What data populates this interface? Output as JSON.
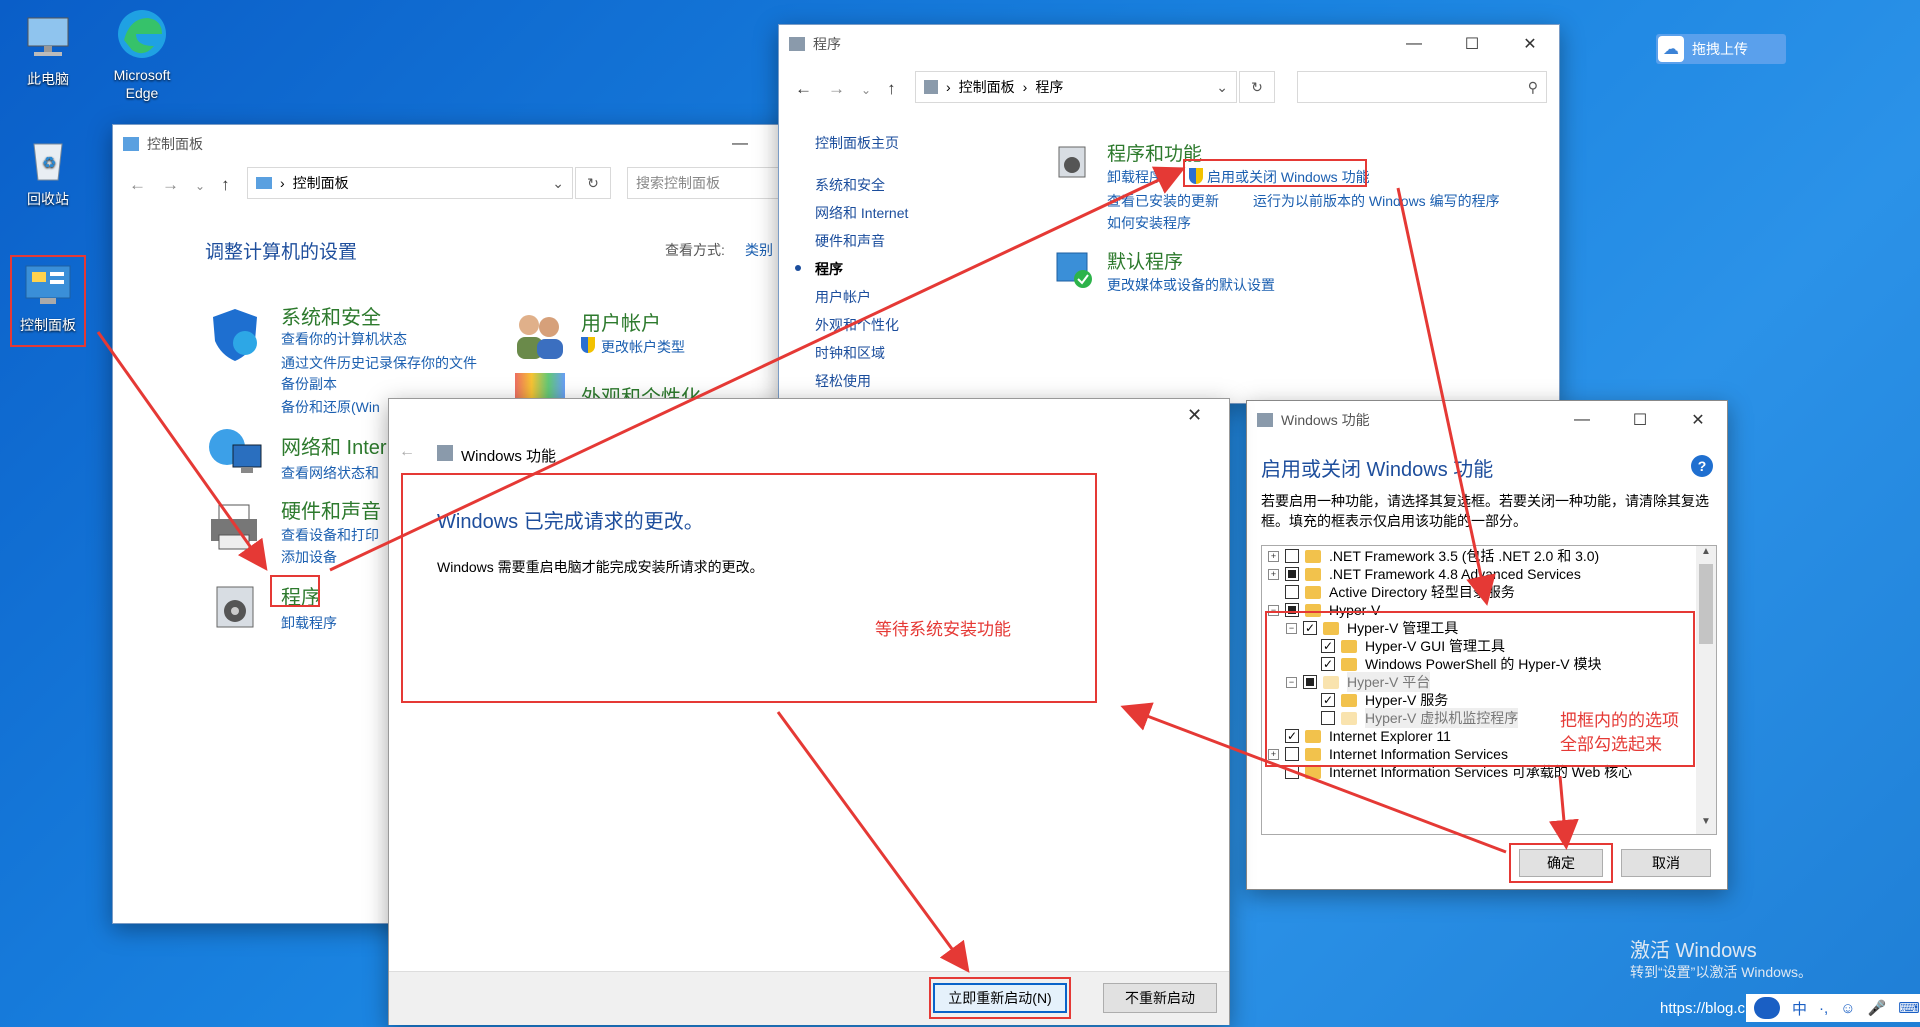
{
  "desktop": {
    "icons": [
      {
        "label": "此电脑",
        "icon": "computer-icon"
      },
      {
        "label": "Microsoft Edge",
        "icon": "edge-icon"
      },
      {
        "label": "回收站",
        "icon": "recycle-bin-icon"
      },
      {
        "label": "控制面板",
        "icon": "control-panel-icon"
      }
    ],
    "upload_button": "拖拽上传",
    "activate_title": "激活 Windows",
    "activate_sub": "转到“设置”以激活 Windows。",
    "url_watermark": "https://blog.c",
    "tray": [
      "中",
      "·,"
    ]
  },
  "cp_window": {
    "title": "控制面板",
    "address": "控制面板",
    "search_placeholder": "搜索控制面板",
    "heading": "调整计算机的设置",
    "view_label": "查看方式:",
    "view_value": "类别",
    "categories": {
      "system": {
        "title": "系统和安全",
        "links": [
          "查看你的计算机状态",
          "通过文件历史记录保存你的文件",
          "备份副本",
          "备份和还原(Win"
        ]
      },
      "user": {
        "title": "用户帐户",
        "links": [
          "更改帐户类型"
        ]
      },
      "appearance": {
        "title": "外观和个性化"
      },
      "network": {
        "title": "网络和 Inter",
        "links": [
          "查看网络状态和"
        ]
      },
      "hardware": {
        "title": "硬件和声音",
        "links": [
          "查看设备和打印",
          "添加设备"
        ]
      },
      "programs": {
        "title": "程序",
        "links": [
          "卸载程序"
        ]
      }
    }
  },
  "prog_window": {
    "title": "程序",
    "breadcrumb": [
      "控制面板",
      "程序"
    ],
    "sidebar": [
      "控制面板主页",
      "系统和安全",
      "网络和 Internet",
      "硬件和声音",
      "程序",
      "用户帐户",
      "外观和个性化",
      "时钟和区域",
      "轻松使用"
    ],
    "section1_title": "程序和功能",
    "section1_links": [
      "卸载程序",
      "启用或关闭 Windows 功能",
      "查看已安装的更新",
      "运行为以前版本的 Windows 编写的程序",
      "如何安装程序"
    ],
    "section2_title": "默认程序",
    "section2_links": [
      "更改媒体或设备的默认设置"
    ]
  },
  "features_window": {
    "title": "Windows 功能",
    "heading": "启用或关闭 Windows 功能",
    "help": "?",
    "description": "若要启用一种功能，请选择其复选框。若要关闭一种功能，请清除其复选框。填充的框表示仅启用该功能的一部分。",
    "items": [
      {
        "label": ".NET Framework 3.5 (包括 .NET 2.0 和 3.0)",
        "state": "unchecked",
        "expand": "+",
        "level": 0
      },
      {
        "label": ".NET Framework 4.8 Advanced Services",
        "state": "partial",
        "expand": "+",
        "level": 0
      },
      {
        "label": "Active Directory 轻型目录服务",
        "state": "unchecked",
        "expand": "",
        "level": 0
      },
      {
        "label": "Hyper-V",
        "state": "partial",
        "expand": "−",
        "level": 0
      },
      {
        "label": "Hyper-V 管理工具",
        "state": "checked",
        "expand": "−",
        "level": 1
      },
      {
        "label": "Hyper-V GUI 管理工具",
        "state": "checked",
        "expand": "",
        "level": 2
      },
      {
        "label": "Windows PowerShell 的 Hyper-V 模块",
        "state": "checked",
        "expand": "",
        "level": 2
      },
      {
        "label": "Hyper-V 平台",
        "state": "partial",
        "expand": "−",
        "level": 1,
        "grey": true
      },
      {
        "label": "Hyper-V 服务",
        "state": "checked",
        "expand": "",
        "level": 2
      },
      {
        "label": "Hyper-V 虚拟机监控程序",
        "state": "unchecked",
        "expand": "",
        "level": 2,
        "grey": true
      },
      {
        "label": "Internet Explorer 11",
        "state": "checked",
        "expand": "",
        "level": 0
      },
      {
        "label": "Internet Information Services",
        "state": "unchecked",
        "expand": "+",
        "level": 0
      },
      {
        "label": "Internet Information Services 可承载的 Web 核心",
        "state": "unchecked",
        "expand": "",
        "level": 0
      }
    ],
    "ok": "确定",
    "cancel": "取消"
  },
  "done_dialog": {
    "title": "Windows 功能",
    "heading": "Windows 已完成请求的更改。",
    "message": "Windows 需要重启电脑才能完成安装所请求的更改。",
    "restart": "立即重新启动(N)",
    "no_restart": "不重新启动"
  },
  "annotations": {
    "wait": "等待系统安装功能",
    "check_line1": "把框内的的选项",
    "check_line2": "全部勾选起来"
  },
  "colors": {
    "annotation_red": "#e53935",
    "link_blue": "#1b5fb0",
    "heading_blue": "#1e4e9c",
    "category_green": "#2d7a2d"
  }
}
